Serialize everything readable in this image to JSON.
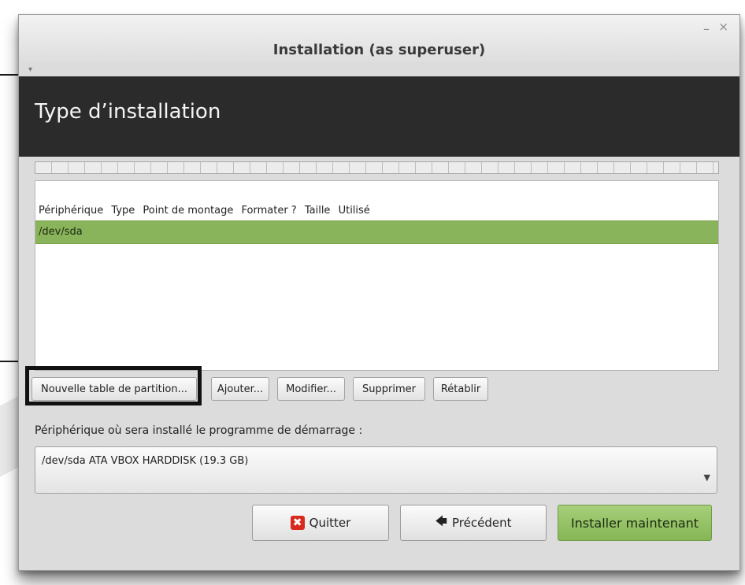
{
  "window": {
    "title": "Installation (as superuser)",
    "menu_arrow": "▾",
    "minimize": "–",
    "close": "×"
  },
  "page_title": "Type d’installation",
  "table": {
    "headers": [
      "Périphérique",
      "Type",
      "Point de montage",
      "Formater ?",
      "Taille",
      "Utilisé"
    ],
    "rows": [
      {
        "device": "/dev/sda",
        "selected": true
      }
    ]
  },
  "partition_buttons": {
    "new_table": "Nouvelle table de partition...",
    "add": "Ajouter...",
    "modify": "Modifier...",
    "delete": "Supprimer",
    "reset": "Rétablir"
  },
  "bootloader": {
    "label": "Périphérique où sera installé le programme de démarrage :",
    "value": "/dev/sda ATA VBOX HARDDISK (19.3 GB)",
    "arrow": "▼"
  },
  "footer": {
    "quit": "Quitter",
    "quit_icon": "✖",
    "back": "Précédent",
    "back_icon": "🡄",
    "install": "Installer maintenant"
  },
  "colors": {
    "header_band": "#2b2b2b",
    "selected_row": "#8ab45c",
    "install_button": "#96c268",
    "quit_icon": "#d8291e"
  }
}
